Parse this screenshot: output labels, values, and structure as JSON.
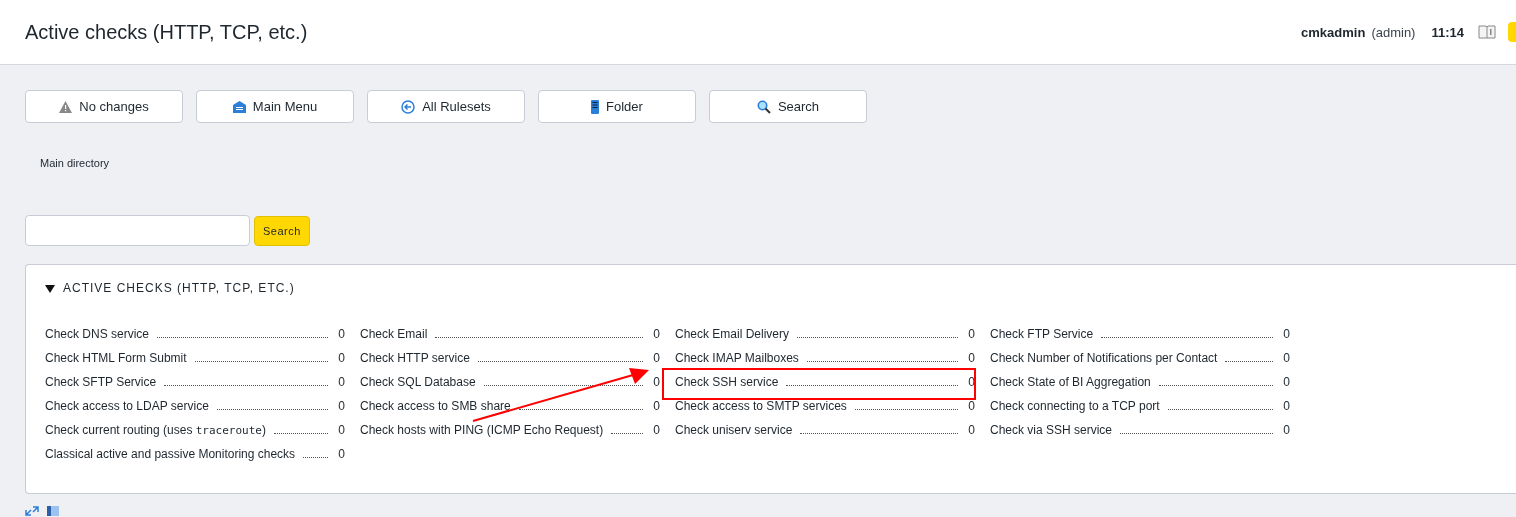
{
  "header": {
    "title": "Active checks (HTTP, TCP, etc.)",
    "user": "cmkadmin",
    "role": "(admin)",
    "time": "11:14"
  },
  "toolbar": [
    {
      "kind": "warning",
      "label": "No changes"
    },
    {
      "kind": "home",
      "label": "Main Menu"
    },
    {
      "kind": "back",
      "label": "All Rulesets"
    },
    {
      "kind": "folder",
      "label": "Folder"
    },
    {
      "kind": "search",
      "label": "Search"
    }
  ],
  "breadcrumb": "Main directory",
  "search": {
    "button": "Search"
  },
  "panel": {
    "title": "ACTIVE CHECKS (HTTP, TCP, ETC.)",
    "expanded": true,
    "items": [
      {
        "parts": [
          {
            "text": "Check DNS service"
          }
        ],
        "count": "0",
        "highlighted": false
      },
      {
        "parts": [
          {
            "text": "Check Email"
          }
        ],
        "count": "0",
        "highlighted": false
      },
      {
        "parts": [
          {
            "text": "Check Email Delivery"
          }
        ],
        "count": "0",
        "highlighted": false
      },
      {
        "parts": [
          {
            "text": "Check FTP Service"
          }
        ],
        "count": "0",
        "highlighted": false
      },
      {
        "parts": [
          {
            "text": "Check HTML Form Submit"
          }
        ],
        "count": "0",
        "highlighted": false
      },
      {
        "parts": [
          {
            "text": "Check HTTP service"
          }
        ],
        "count": "0",
        "highlighted": false
      },
      {
        "parts": [
          {
            "text": "Check IMAP Mailboxes"
          }
        ],
        "count": "0",
        "highlighted": false
      },
      {
        "parts": [
          {
            "text": "Check Number of Notifications per Contact"
          }
        ],
        "count": "0",
        "highlighted": false
      },
      {
        "parts": [
          {
            "text": "Check SFTP Service"
          }
        ],
        "count": "0",
        "highlighted": false
      },
      {
        "parts": [
          {
            "text": "Check SQL Database"
          }
        ],
        "count": "0",
        "highlighted": false
      },
      {
        "parts": [
          {
            "text": "Check SSH service"
          }
        ],
        "count": "0",
        "highlighted": true,
        "arrow": true
      },
      {
        "parts": [
          {
            "text": "Check State of BI Aggregation"
          }
        ],
        "count": "0",
        "highlighted": false
      },
      {
        "parts": [
          {
            "text": "Check access to LDAP service"
          }
        ],
        "count": "0",
        "highlighted": false
      },
      {
        "parts": [
          {
            "text": "Check access to SMB share"
          }
        ],
        "count": "0",
        "highlighted": false
      },
      {
        "parts": [
          {
            "text": "Check access to SMTP services"
          }
        ],
        "count": "0",
        "highlighted": false
      },
      {
        "parts": [
          {
            "text": "Check connecting to a TCP port"
          }
        ],
        "count": "0",
        "highlighted": false
      },
      {
        "parts": [
          {
            "text": "Check current routing (uses "
          },
          {
            "text": "traceroute",
            "mono": true
          },
          {
            "text": ")"
          }
        ],
        "count": "0",
        "highlighted": false
      },
      {
        "parts": [
          {
            "text": "Check hosts with PING (ICMP Echo Request)"
          }
        ],
        "count": "0",
        "highlighted": false
      },
      {
        "parts": [
          {
            "text": "Check uniserv service"
          }
        ],
        "count": "0",
        "highlighted": false
      },
      {
        "parts": [
          {
            "text": "Check via SSH service"
          }
        ],
        "count": "0",
        "highlighted": false
      },
      {
        "parts": [
          {
            "text": "Classical active and passive Monitoring checks"
          }
        ],
        "count": "0",
        "highlighted": false
      }
    ]
  }
}
